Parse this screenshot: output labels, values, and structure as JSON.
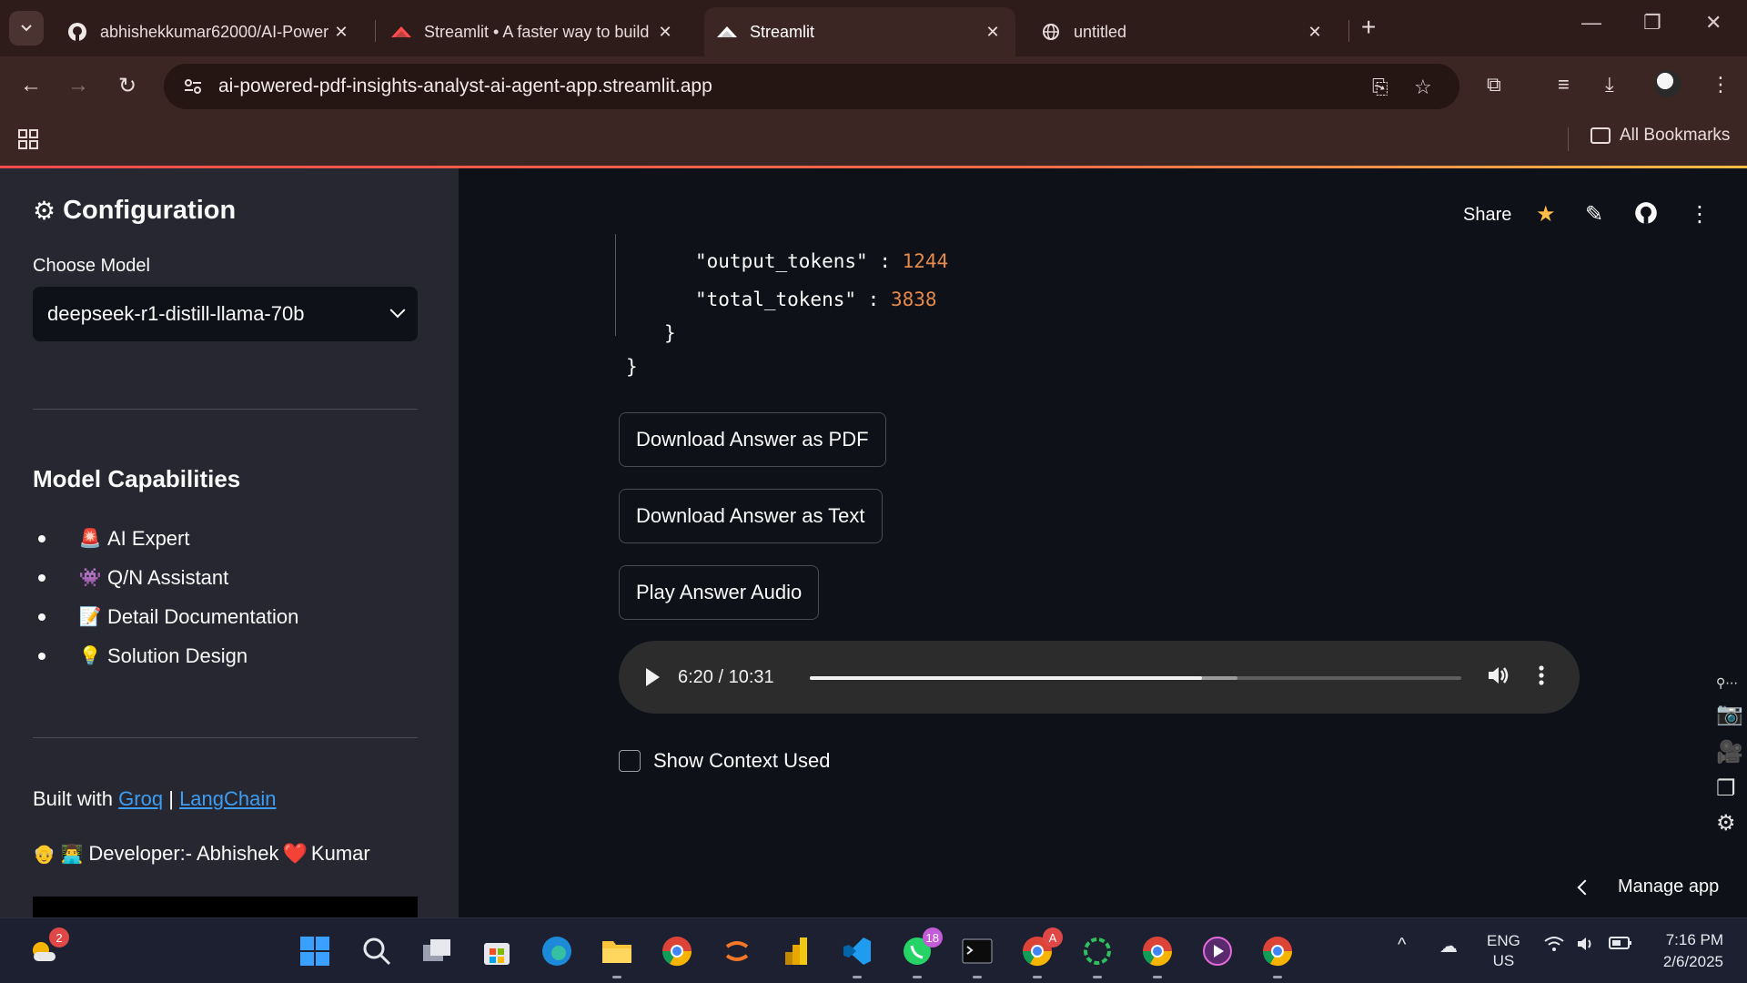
{
  "browser": {
    "tabs": [
      {
        "title": "abhishekkumar62000/AI-Power",
        "icon": "github-icon"
      },
      {
        "title": "Streamlit • A faster way to build",
        "icon": "streamlit-icon"
      },
      {
        "title": "Streamlit",
        "icon": "streamlit-icon",
        "active": true
      },
      {
        "title": "untitled",
        "icon": "globe-icon"
      }
    ],
    "url": "ai-powered-pdf-insights-analyst-ai-agent-app.streamlit.app",
    "all_bookmarks": "All Bookmarks"
  },
  "sidebar": {
    "title": "Configuration",
    "choose_model_label": "Choose Model",
    "selected_model": "deepseek-r1-distill-llama-70b",
    "capabilities_title": "Model Capabilities",
    "capabilities": [
      {
        "emoji": "🚨",
        "label": "AI Expert"
      },
      {
        "emoji": "👾",
        "label": "Q/N Assistant"
      },
      {
        "emoji": "📝",
        "label": "Detail Documentation"
      },
      {
        "emoji": "💡",
        "label": "Solution Design"
      }
    ],
    "built_with_prefix": "Built with",
    "built_with_link1": "Groq",
    "built_with_sep": "|",
    "built_with_link2": "LangChain",
    "developer_emoji": "👴 👨‍💻",
    "developer_prefix": "Developer:- Abhishek",
    "developer_heart": "❤️",
    "developer_suffix": "Kumar"
  },
  "header": {
    "share_label": "Share"
  },
  "json_view": {
    "output_tokens_key": "\"output_tokens\"",
    "output_tokens_value": "1244",
    "total_tokens_key": "\"total_tokens\"",
    "total_tokens_value": "3838",
    "colon": ":",
    "inner_close": "}",
    "outer_close": "}"
  },
  "buttons": {
    "download_pdf": "Download Answer as PDF",
    "download_text": "Download Answer as Text",
    "play_audio": "Play Answer Audio"
  },
  "audio": {
    "time": "6:20 / 10:31",
    "played_fraction": 0.602,
    "buffered_fraction": 0.657
  },
  "show_context_label": "Show Context Used",
  "manage_app_label": "Manage app",
  "taskbar": {
    "weather_badge": "2",
    "whatsapp_badge": "18",
    "chrome_badge": "A",
    "lang_top": "ENG",
    "lang_bottom": "US",
    "time": "7:16 PM",
    "date": "2/6/2025"
  },
  "colors": {
    "accent_link": "#3d9df3",
    "json_number": "#e58a4a",
    "sidebar_bg": "#262730",
    "main_bg": "#0e1117",
    "chrome_bg": "#3c2623"
  }
}
